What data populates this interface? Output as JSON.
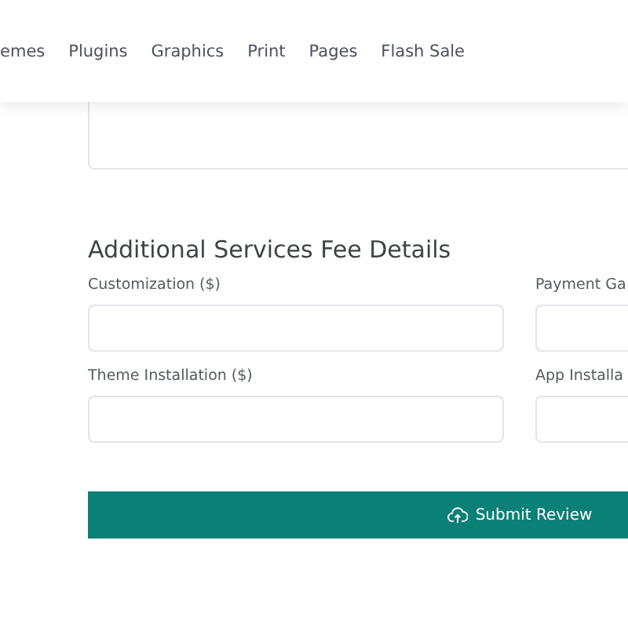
{
  "nav": {
    "items": [
      "emes",
      "Plugins",
      "Graphics",
      "Print",
      "Pages",
      "Flash Sale"
    ]
  },
  "form": {
    "section_title": "Additional Services Fee Details",
    "fields": [
      {
        "label": "Customization ($)"
      },
      {
        "label": "Payment Ga"
      },
      {
        "label": "Theme Installation ($)"
      },
      {
        "label": "App Installa"
      }
    ],
    "submit": "Submit Review"
  }
}
